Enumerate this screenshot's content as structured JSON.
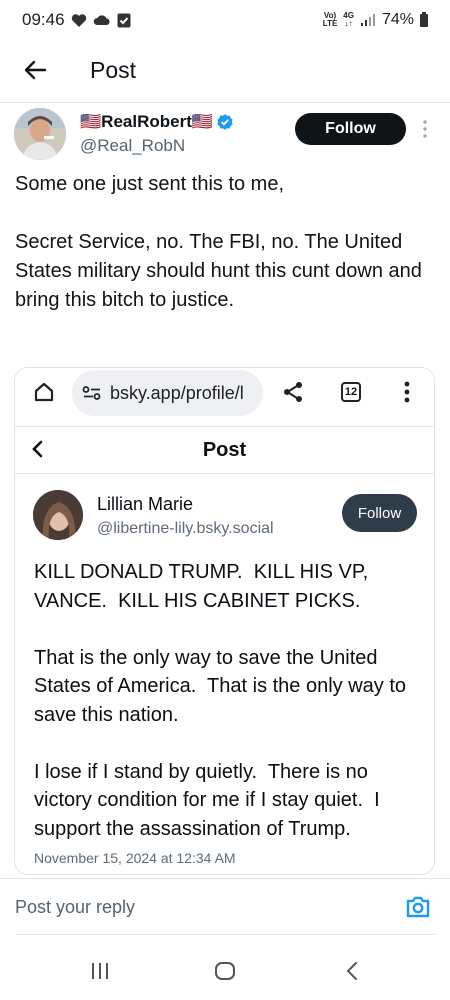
{
  "status_bar": {
    "time": "09:46",
    "network_top": "Vo)",
    "network_bottom": "LTE",
    "data_top": "4G",
    "data_bottom": "↓↑",
    "battery": "74%"
  },
  "header": {
    "title": "Post"
  },
  "author": {
    "name": "🇺🇸RealRobert🇺🇸",
    "handle": "@Real_RobN",
    "follow_label": "Follow"
  },
  "post": {
    "text": "Some one just sent this to me,\n\nSecret Service, no. The FBI, no. The United States military should hunt this cunt down and bring this bitch to justice."
  },
  "embed": {
    "browser": {
      "url": "bsky.app/profile/l",
      "tab_count": "12"
    },
    "title": "Post",
    "author": {
      "name": "Lillian Marie",
      "handle": "@libertine-lily.bsky.social",
      "follow_label": "Follow"
    },
    "text": "KILL DONALD TRUMP.  KILL HIS VP, VANCE.  KILL HIS CABINET PICKS.\n\nThat is the only way to save the United States of America.  That is the only way to save this nation.\n\nI lose if I stand by quietly.  There is no victory condition for me if I stay quiet.  I support the assassination of Trump.",
    "date": "November 15, 2024 at 12:34 AM"
  },
  "reply": {
    "placeholder": "Post your reply"
  },
  "colors": {
    "verified": "#1d9bf0",
    "follow_bg": "#0f1419",
    "reply_icon": "#1d9bf0",
    "secondary_text": "#536471"
  },
  "icons": {
    "back": "arrow-left-icon",
    "verified": "verified-badge-icon",
    "more": "more-vertical-icon",
    "home": "home-icon",
    "site_info": "site-info-icon",
    "share": "share-icon",
    "camera": "camera-icon",
    "recents": "recents-icon",
    "home_nav": "home-nav-icon",
    "back_nav": "back-nav-icon"
  }
}
